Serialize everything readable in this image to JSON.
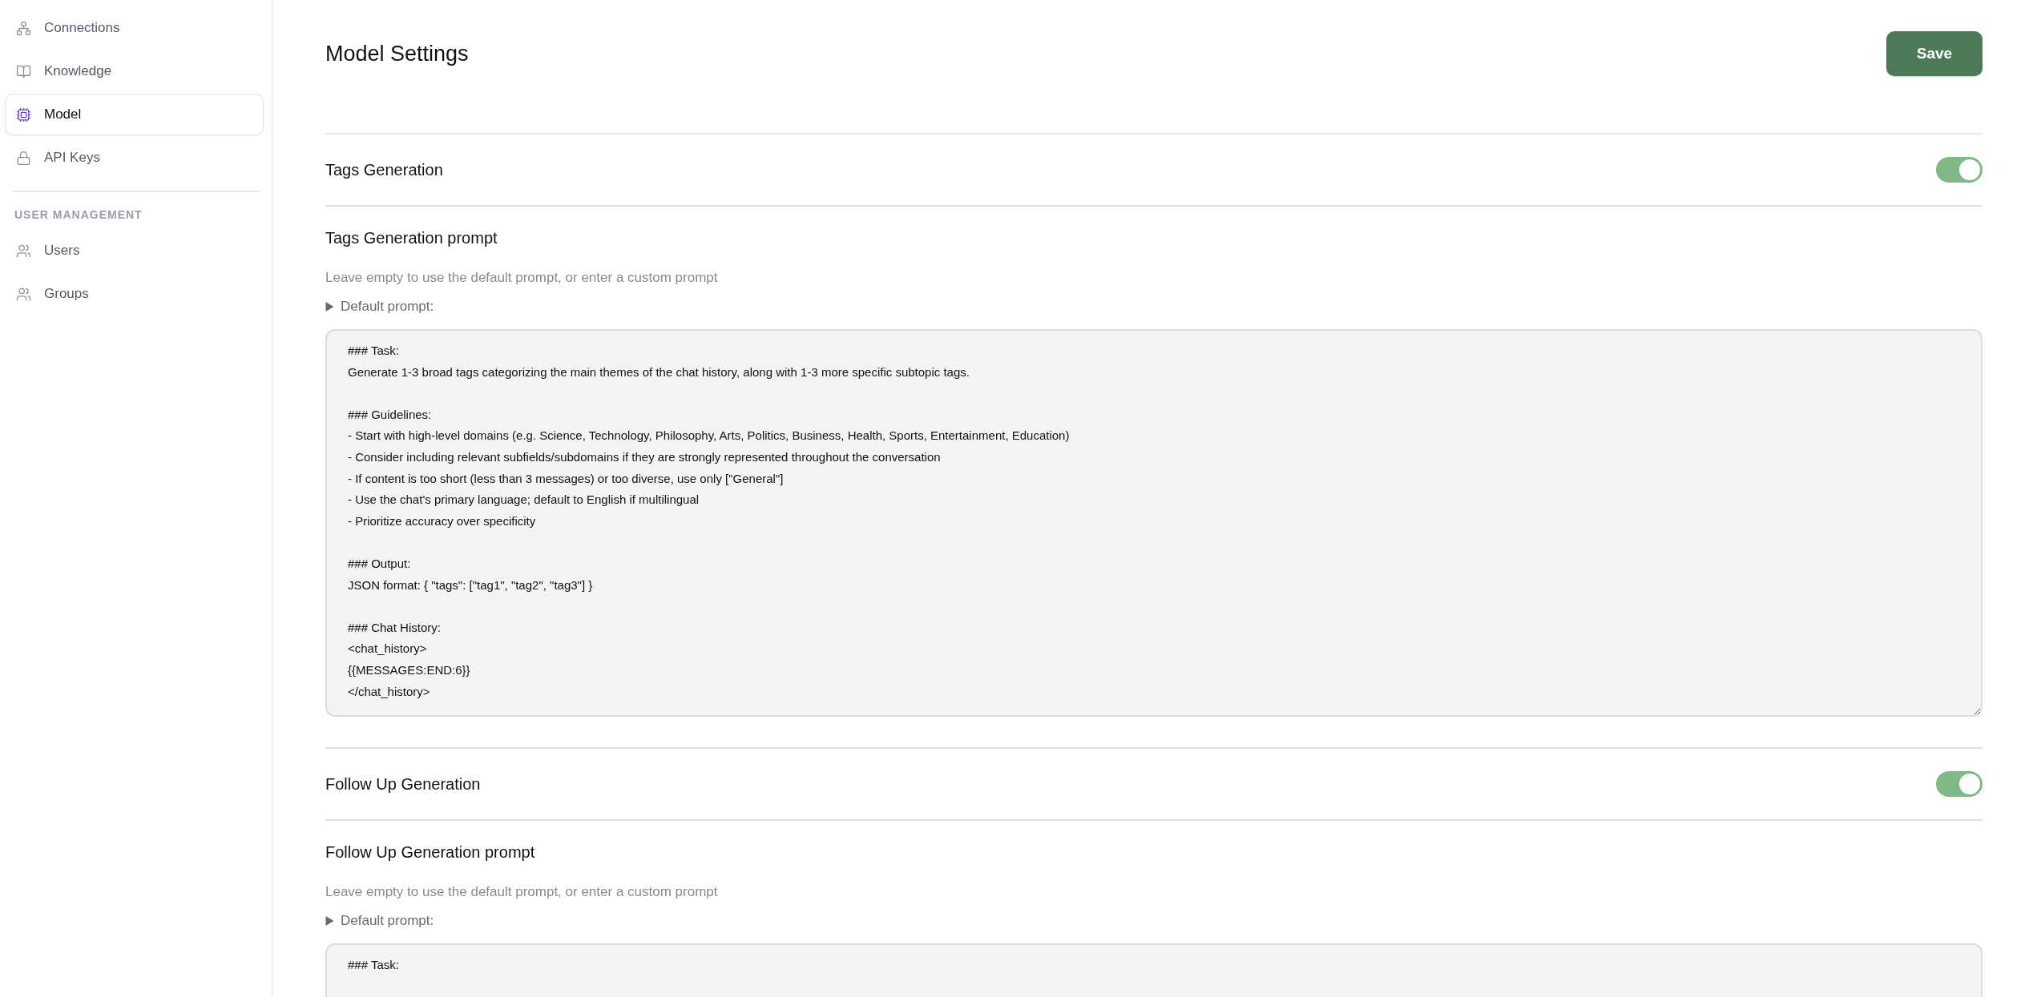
{
  "sidebar": {
    "groups": [
      {
        "items": [
          {
            "label": "Connections",
            "selected": false
          },
          {
            "label": "Knowledge",
            "selected": false
          },
          {
            "label": "Model",
            "selected": true
          },
          {
            "label": "API Keys",
            "selected": false
          }
        ]
      },
      {
        "heading": "USER MANAGEMENT",
        "items": [
          {
            "label": "Users",
            "selected": false
          },
          {
            "label": "Groups",
            "selected": false
          }
        ]
      }
    ]
  },
  "page": {
    "title": "Model Settings",
    "save_button": "Save"
  },
  "sections": [
    {
      "title": "Tags Generation",
      "on": true,
      "prompt_title": "Tags Generation prompt",
      "hint": "Leave empty to use the default prompt, or enter a custom prompt",
      "default_label": "Default prompt:",
      "expanded": false,
      "prompt_value": "### Task:\nGenerate 1-3 broad tags categorizing the main themes of the chat history, along with 1-3 more specific subtopic tags.\n\n### Guidelines:\n- Start with high-level domains (e.g. Science, Technology, Philosophy, Arts, Politics, Business, Health, Sports, Entertainment, Education)\n- Consider including relevant subfields/subdomains if they are strongly represented throughout the conversation\n- If content is too short (less than 3 messages) or too diverse, use only [\"General\"]\n- Use the chat's primary language; default to English if multilingual\n- Prioritize accuracy over specificity\n\n### Output:\nJSON format: { \"tags\": [\"tag1\", \"tag2\", \"tag3\"] }\n\n### Chat History:\n<chat_history>\n{{MESSAGES:END:6}}\n</chat_history>"
    },
    {
      "title": "Follow Up Generation",
      "on": true,
      "prompt_title": "Follow Up Generation prompt",
      "hint": "Leave empty to use the default prompt, or enter a custom prompt",
      "default_label": "Default prompt:",
      "expanded": false,
      "prompt_value": "### Task:"
    }
  ]
}
